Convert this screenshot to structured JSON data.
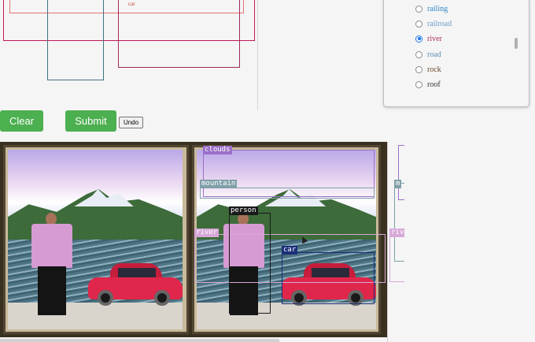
{
  "canvas": {
    "box_label": "car"
  },
  "labels": {
    "items": [
      {
        "name": "railing",
        "color": "#2f86c9",
        "checked": false
      },
      {
        "name": "railroad",
        "color": "#6a9bc9",
        "checked": false
      },
      {
        "name": "river",
        "color": "#b03060",
        "checked": true
      },
      {
        "name": "road",
        "color": "#5e8fb0",
        "checked": false
      },
      {
        "name": "rock",
        "color": "#6b4a2a",
        "checked": false
      },
      {
        "name": "roof",
        "color": "#333333",
        "checked": false
      }
    ]
  },
  "buttons": {
    "clear_label": "Clear",
    "submit_label": "Submit",
    "undo_label": "Undo"
  },
  "result": {
    "detections": {
      "clouds": "clouds",
      "mountain": "mountain",
      "person": "person",
      "river": "river",
      "car": "car"
    }
  },
  "side_strip": {
    "tags": [
      "m",
      "rive"
    ]
  },
  "colors": {
    "accent_green": "#4caf50",
    "clouds_tag": "#9b6fc9",
    "mountain_tag": "#7f9fa8",
    "person_tag": "#1a1a1a",
    "river_tag": "#d7a8d8",
    "car_tag": "#1c2f7a"
  }
}
